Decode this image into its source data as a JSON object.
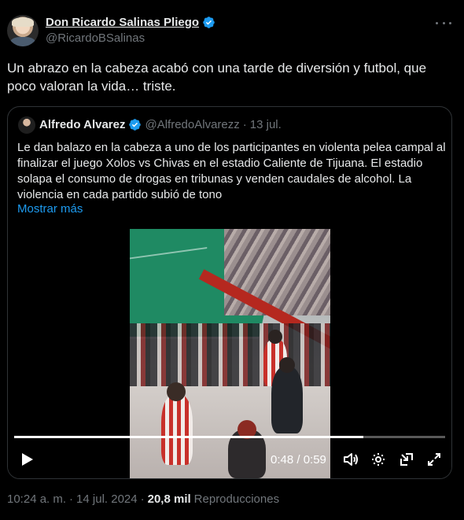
{
  "author": {
    "display_name": "Don Ricardo Salinas Pliego",
    "handle": "@RicardoBSalinas"
  },
  "tweet": {
    "text": "Un abrazo en la cabeza acabó con una tarde de diversión y futbol, que poco valoran la vida… triste."
  },
  "quoted": {
    "display_name": "Alfredo Alvarez",
    "handle": "@AlfredoAlvarezz",
    "separator": "·",
    "date": "13 jul.",
    "text": "Le dan balazo en la cabeza a uno de los participantes en violenta pelea campal al finalizar el juego Xolos vs Chivas en el estadio Caliente de Tijuana. El estadio solapa el consumo de drogas en tribunas y venden caudales de alcohol. La violencia en cada partido subió de tono",
    "show_more": "Mostrar más"
  },
  "video": {
    "time_display": "0:48 / 0:59",
    "progress": 0.81
  },
  "footer": {
    "time": "10:24 a. m.",
    "separator1": "·",
    "date": "14 jul. 2024",
    "separator2": "·",
    "views_count": "20,8 mil",
    "views_label": "Reproducciones"
  },
  "colors": {
    "background": "#000000",
    "text": "#e7e9ea",
    "secondary": "#71767b",
    "link": "#1d9bf0",
    "verified": "#1d9bf0",
    "border": "#2f3336"
  },
  "icons": [
    "verified-badge-icon",
    "more-icon",
    "play-icon",
    "volume-icon",
    "settings-icon",
    "pip-icon",
    "fullscreen-icon"
  ]
}
